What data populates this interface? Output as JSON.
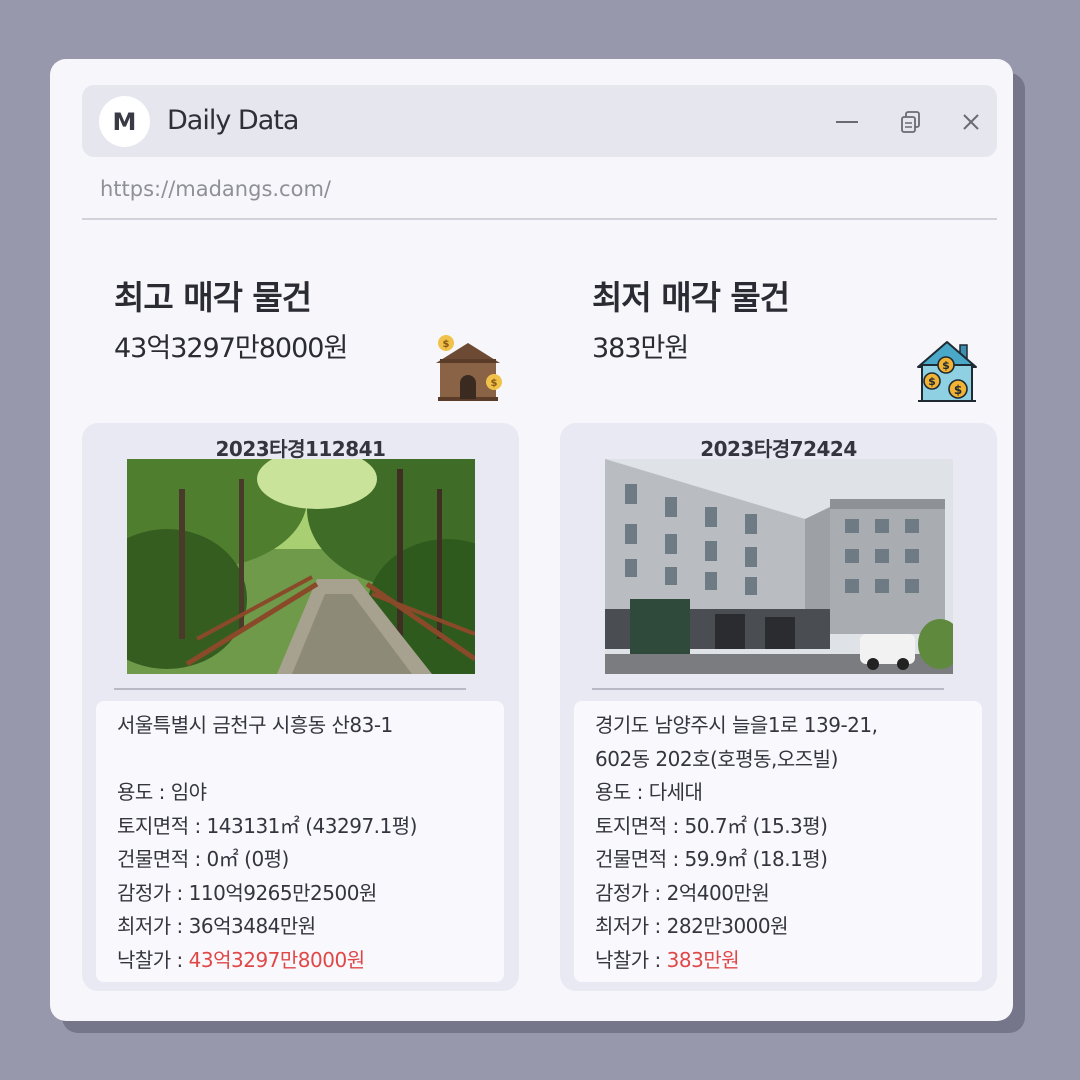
{
  "app": {
    "logo_letter": "M",
    "title": "Daily Data",
    "url": "https://madangs.com/"
  },
  "window_controls": {
    "minimize_icon": "minimize-icon",
    "restore_icon": "restore-icon",
    "close_icon": "close-icon"
  },
  "highest": {
    "heading": "최고 매각 물건",
    "price": "43억3297만8000원",
    "icon": "house-money-icon",
    "case_no": "2023타경112841",
    "photo": "forest-trail-photo",
    "address_line1": "서울특별시 금천구 시흥동 산83-1",
    "address_line2": "",
    "usage": "용도 : 임야",
    "land_area": "토지면적 : 143131㎡ (43297.1평)",
    "building_area": "건물면적 : 0㎡ (0평)",
    "appraisal": "감정가 : 110억9265만2500원",
    "minimum": "최저가 : 36억3484만원",
    "winning_label": "낙찰가 : ",
    "winning_value": "43억3297만8000원"
  },
  "lowest": {
    "heading": "최저 매각 물건",
    "price": "383만원",
    "icon": "house-coins-icon",
    "case_no": "2023타경72424",
    "photo": "apartment-building-photo",
    "address_line1": "경기도 남양주시 늘을1로 139-21,",
    "address_line2": "602동 202호(호평동,오즈빌)",
    "usage": "용도 : 다세대",
    "land_area": "토지면적 : 50.7㎡ (15.3평)",
    "building_area": "건물면적 : 59.9㎡ (18.1평)",
    "appraisal": "감정가 :  2억400만원",
    "minimum": "최저가 : 282만3000원",
    "winning_label": "낙찰가 : ",
    "winning_value": "383만원"
  },
  "colors": {
    "background": "#9898ad",
    "window": "#f7f7fb",
    "card": "#e9e9f4",
    "winning_price": "#e04848"
  }
}
